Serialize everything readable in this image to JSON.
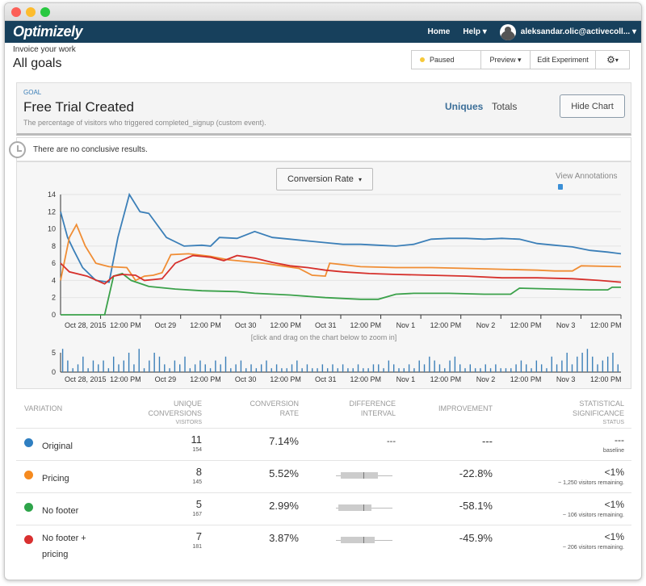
{
  "app": {
    "brand": "Optimizely"
  },
  "nav": {
    "home": "Home",
    "help": "Help",
    "user": "aleksandar.olic@activecoll..."
  },
  "page": {
    "subtitle": "Invoice your work",
    "title": "All goals"
  },
  "toolbar": {
    "status": "Paused",
    "preview": "Preview",
    "edit": "Edit Experiment"
  },
  "goal": {
    "tag": "GOAL",
    "name": "Free Trial Created",
    "desc": "The percentage of visitors who triggered completed_signup (custom event).",
    "tab_uniques": "Uniques",
    "tab_totals": "Totals",
    "hide_chart": "Hide Chart"
  },
  "notice": "There are no conclusive results.",
  "chart_controls": {
    "metric": "Conversion Rate",
    "annotations": "View Annotations",
    "zoom_hint": "[click and drag on the chart below to zoom in]"
  },
  "chart_data": [
    {
      "type": "line",
      "ylim": [
        0,
        14
      ],
      "yticks": [
        "0",
        "2",
        "4",
        "6",
        "8",
        "10",
        "12",
        "14"
      ],
      "xticks": [
        "Oct 28, 2015",
        "12:00 PM",
        "Oct 29",
        "12:00 PM",
        "Oct 30",
        "12:00 PM",
        "Oct 31",
        "12:00 PM",
        "Nov 1",
        "12:00 PM",
        "Nov 2",
        "12:00 PM",
        "Nov 3",
        "12:00 PM"
      ],
      "x_range_days": [
        0,
        6.35
      ],
      "series": [
        {
          "color": "#3b7fb8",
          "points": [
            [
              0,
              12
            ],
            [
              0.08,
              9
            ],
            [
              0.15,
              7.5
            ],
            [
              0.25,
              5.5
            ],
            [
              0.4,
              4
            ],
            [
              0.55,
              3.8
            ],
            [
              0.65,
              9
            ],
            [
              0.78,
              14
            ],
            [
              0.9,
              12
            ],
            [
              1.0,
              11.8
            ],
            [
              1.2,
              9
            ],
            [
              1.4,
              8
            ],
            [
              1.6,
              8.1
            ],
            [
              1.7,
              8
            ],
            [
              1.8,
              9
            ],
            [
              2.0,
              8.9
            ],
            [
              2.2,
              9.7
            ],
            [
              2.4,
              9
            ],
            [
              2.6,
              8.8
            ],
            [
              2.8,
              8.6
            ],
            [
              3.0,
              8.4
            ],
            [
              3.2,
              8.2
            ],
            [
              3.4,
              8.2
            ],
            [
              3.6,
              8.1
            ],
            [
              3.8,
              8.0
            ],
            [
              4.0,
              8.2
            ],
            [
              4.2,
              8.8
            ],
            [
              4.4,
              8.9
            ],
            [
              4.6,
              8.9
            ],
            [
              4.8,
              8.8
            ],
            [
              5.0,
              8.9
            ],
            [
              5.2,
              8.8
            ],
            [
              5.4,
              8.3
            ],
            [
              5.6,
              8.1
            ],
            [
              5.8,
              7.9
            ],
            [
              6.0,
              7.5
            ],
            [
              6.2,
              7.3
            ],
            [
              6.35,
              7.1
            ]
          ]
        },
        {
          "color": "#f08d34",
          "points": [
            [
              0,
              4
            ],
            [
              0.1,
              9
            ],
            [
              0.18,
              10.5
            ],
            [
              0.28,
              8
            ],
            [
              0.4,
              6
            ],
            [
              0.55,
              5.6
            ],
            [
              0.75,
              5.5
            ],
            [
              0.85,
              4
            ],
            [
              0.95,
              4.5
            ],
            [
              1.05,
              4.6
            ],
            [
              1.15,
              4.9
            ],
            [
              1.25,
              7
            ],
            [
              1.45,
              7.1
            ],
            [
              1.7,
              6.8
            ],
            [
              1.9,
              6.4
            ],
            [
              2.1,
              6.2
            ],
            [
              2.3,
              6.0
            ],
            [
              2.5,
              5.7
            ],
            [
              2.7,
              5.4
            ],
            [
              2.85,
              4.6
            ],
            [
              3.0,
              4.5
            ],
            [
              3.05,
              6.0
            ],
            [
              3.4,
              5.6
            ],
            [
              3.8,
              5.5
            ],
            [
              4.2,
              5.5
            ],
            [
              4.6,
              5.4
            ],
            [
              5.0,
              5.3
            ],
            [
              5.4,
              5.2
            ],
            [
              5.6,
              5.1
            ],
            [
              5.8,
              5.1
            ],
            [
              5.9,
              5.7
            ],
            [
              6.35,
              5.6
            ]
          ]
        },
        {
          "color": "#3ba14a",
          "points": [
            [
              0,
              0
            ],
            [
              0.35,
              0
            ],
            [
              0.5,
              0
            ],
            [
              0.6,
              4.5
            ],
            [
              0.7,
              4.8
            ],
            [
              0.8,
              4
            ],
            [
              1.0,
              3.3
            ],
            [
              1.3,
              3
            ],
            [
              1.6,
              2.8
            ],
            [
              2.0,
              2.7
            ],
            [
              2.2,
              2.5
            ],
            [
              2.6,
              2.3
            ],
            [
              3.0,
              2.0
            ],
            [
              3.4,
              1.8
            ],
            [
              3.6,
              1.8
            ],
            [
              3.8,
              2.4
            ],
            [
              4.0,
              2.5
            ],
            [
              4.4,
              2.5
            ],
            [
              4.8,
              2.4
            ],
            [
              5.1,
              2.4
            ],
            [
              5.2,
              3.1
            ],
            [
              5.6,
              3.0
            ],
            [
              6.0,
              2.9
            ],
            [
              6.2,
              2.9
            ],
            [
              6.25,
              3.2
            ],
            [
              6.35,
              3.2
            ]
          ]
        },
        {
          "color": "#d6302b",
          "points": [
            [
              0,
              6
            ],
            [
              0.1,
              5
            ],
            [
              0.3,
              4.5
            ],
            [
              0.5,
              3.6
            ],
            [
              0.6,
              4.5
            ],
            [
              0.7,
              4.7
            ],
            [
              0.85,
              4.6
            ],
            [
              0.95,
              4.0
            ],
            [
              1.05,
              4.1
            ],
            [
              1.15,
              4.2
            ],
            [
              1.3,
              6
            ],
            [
              1.5,
              6.9
            ],
            [
              1.7,
              6.7
            ],
            [
              1.85,
              6.3
            ],
            [
              2.0,
              6.9
            ],
            [
              2.2,
              6.6
            ],
            [
              2.4,
              6.1
            ],
            [
              2.6,
              5.7
            ],
            [
              2.8,
              5.5
            ],
            [
              3.0,
              5.2
            ],
            [
              3.2,
              5.0
            ],
            [
              3.5,
              4.8
            ],
            [
              3.8,
              4.7
            ],
            [
              4.2,
              4.6
            ],
            [
              4.6,
              4.5
            ],
            [
              5.0,
              4.3
            ],
            [
              5.4,
              4.3
            ],
            [
              5.8,
              4.2
            ],
            [
              6.1,
              4.0
            ],
            [
              6.35,
              3.8
            ]
          ]
        }
      ]
    },
    {
      "type": "bar",
      "ylim": [
        0,
        5
      ],
      "yticks": [
        "0",
        "5"
      ],
      "xticks": [
        "Oct 28, 2015",
        "12:00 PM",
        "Oct 29",
        "12:00 PM",
        "Oct 30",
        "12:00 PM",
        "Oct 31",
        "12:00 PM",
        "Nov 1",
        "12:00 PM",
        "Nov 2",
        "12:00 PM",
        "Nov 3",
        "12:00 PM"
      ],
      "values": [
        6,
        3,
        1,
        2,
        4,
        1,
        3,
        2,
        3,
        1,
        4,
        2,
        3,
        5,
        2,
        6,
        1,
        3,
        5,
        4,
        2,
        1,
        3,
        2,
        4,
        1,
        2,
        3,
        2,
        1,
        3,
        2,
        4,
        1,
        2,
        3,
        1,
        2,
        1,
        2,
        3,
        1,
        2,
        1,
        1,
        2,
        3,
        1,
        2,
        1,
        1,
        2,
        1,
        2,
        1,
        2,
        1,
        1,
        2,
        1,
        1,
        2,
        2,
        1,
        3,
        2,
        1,
        1,
        2,
        1,
        3,
        2,
        4,
        3,
        2,
        1,
        3,
        4,
        2,
        1,
        2,
        1,
        1,
        2,
        1,
        2,
        1,
        1,
        1,
        2,
        3,
        2,
        1,
        3,
        2,
        1,
        4,
        2,
        3,
        5,
        2,
        4,
        5,
        6,
        4,
        2,
        3,
        4,
        5,
        2
      ]
    }
  ],
  "table": {
    "headers": {
      "variation": "VARIATION",
      "unique1": "UNIQUE",
      "unique2": "CONVERSIONS",
      "unique3": "VISITORS",
      "rate1": "CONVERSION",
      "rate2": "RATE",
      "diff1": "DIFFERENCE",
      "diff2": "INTERVAL",
      "improve": "IMPROVEMENT",
      "stat1": "STATISTICAL",
      "stat2": "SIGNIFICANCE",
      "stat3": "STATUS"
    },
    "rows": [
      {
        "color": "#2f7fc1",
        "name": "Original",
        "name2": "",
        "conv": "11",
        "visitors": "154",
        "rate": "7.14%",
        "diff": "---",
        "improve": "---",
        "sig": "---",
        "sig_sub": "baseline",
        "interval": null
      },
      {
        "color": "#f58a1f",
        "name": "Pricing",
        "name2": "",
        "conv": "8",
        "visitors": "145",
        "rate": "5.52%",
        "diff": "",
        "improve": "-22.8%",
        "sig": "<1%",
        "sig_sub": "~ 1,250 visitors remaining.",
        "interval": [
          0.08,
          0.75,
          0.48
        ]
      },
      {
        "color": "#2ea44a",
        "name": "No footer",
        "name2": "",
        "conv": "5",
        "visitors": "167",
        "rate": "2.99%",
        "diff": "",
        "improve": "-58.1%",
        "sig": "<1%",
        "sig_sub": "~ 106 visitors remaining.",
        "interval": [
          0.04,
          0.63,
          0.48
        ]
      },
      {
        "color": "#d93030",
        "name": "No footer +",
        "name2": "pricing",
        "conv": "7",
        "visitors": "181",
        "rate": "3.87%",
        "diff": "",
        "improve": "-45.9%",
        "sig": "<1%",
        "sig_sub": "~ 206 visitors remaining.",
        "interval": [
          0.08,
          0.68,
          0.48
        ]
      }
    ]
  }
}
